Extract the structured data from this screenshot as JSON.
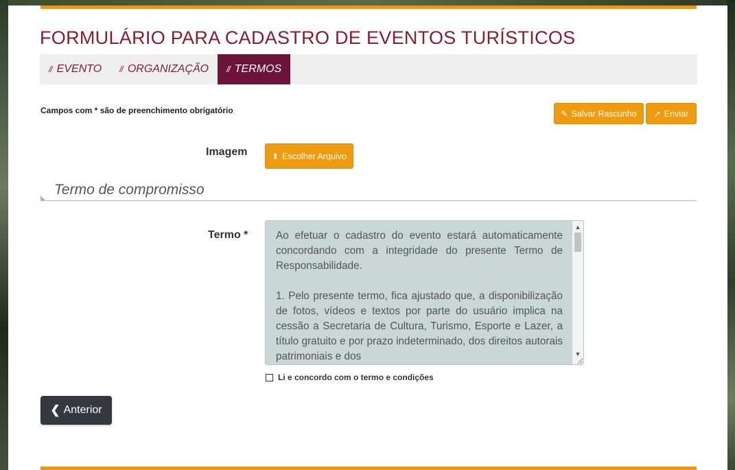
{
  "page": {
    "title": "FORMULÁRIO PARA CADASTRO DE EVENTOS TURÍSTICOS"
  },
  "tabs": [
    {
      "label": "EVENTO",
      "active": false
    },
    {
      "label": "ORGANIZAÇÃO",
      "active": false
    },
    {
      "label": "TERMOS",
      "active": true
    }
  ],
  "tab_prefix": "//",
  "required_note": "Campos com * são de preenchimento obrigatório",
  "toolbar": {
    "save_label": "Salvar Rascunho",
    "send_label": "Enviar",
    "save_icon": "edit-icon",
    "send_icon": "share-icon"
  },
  "image_field": {
    "label": "Imagem",
    "button_label": "Escolher Arquivo",
    "button_icon": "upload-icon"
  },
  "section": {
    "title": "Termo de compromisso"
  },
  "termo": {
    "label": "Termo *",
    "paragraphs": [
      "Ao efetuar o cadastro do evento estará automaticamente concordando com a integridade do presente Termo de Responsabilidade.",
      "1. Pelo presente termo, fica ajustado que, a disponibilização de fotos, vídeos e textos por parte do usuário implica na cessão a Secretaria de Cultura, Turismo, Esporte e Lazer, a título gratuito e por prazo indeterminado, dos direitos autorais patrimoniais e dos"
    ]
  },
  "agree": {
    "label": "Li e concordo com o termo e condições",
    "checked": false
  },
  "nav": {
    "prev_label": "Anterior",
    "prev_icon": "chevron-left-icon"
  },
  "colors": {
    "accent_orange": "#ef9b12",
    "title_red": "#8a1c2b",
    "active_tab": "#6d1238",
    "prev_button": "#35393f",
    "termo_bg": "#c9d7d5"
  }
}
